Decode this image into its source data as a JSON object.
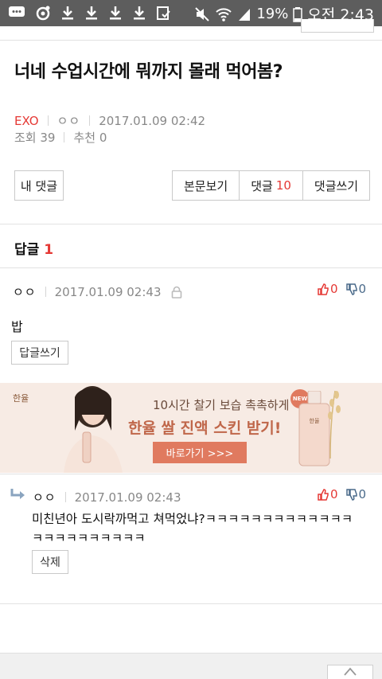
{
  "status_bar": {
    "battery_percent": "19%",
    "time": "오전 2:43"
  },
  "post": {
    "title": "너네 수업시간에 뭐까지 몰래 먹어봄?",
    "category": "EXO",
    "author": "ㅇㅇ",
    "datetime": "2017.01.09 02:42",
    "views": "조회 39",
    "recommends": "추천 0"
  },
  "actions": {
    "my_comments": "내 댓글",
    "view_post": "본문보기",
    "comments_label": "댓글",
    "comments_count": "10",
    "write_comment": "댓글쓰기"
  },
  "replies_section": {
    "label": "답글",
    "count": "1"
  },
  "comments": [
    {
      "author": "ㅇㅇ",
      "datetime": "2017.01.09 02:43",
      "likes": "0",
      "dislikes": "0",
      "text": "밥",
      "button": "답글쓰기"
    },
    {
      "author": "ㅇㅇ",
      "datetime": "2017.01.09 02:43",
      "likes": "0",
      "dislikes": "0",
      "text_line1": "미친년아 도시락까먹고 쳐먹었냐?ㅋㅋㅋㅋㅋㅋㅋㅋㅋㅋㅋㅋㅋ",
      "text_line2": "ㅋㅋㅋㅋㅋㅋㅋㅋㅋㅋ",
      "button": "삭제"
    }
  ],
  "ad": {
    "brand": "한율",
    "line1": "10시간 촉촉하게",
    "line1_full": "10시간 찰기 보습 촉촉하게",
    "line2": "한율 쌀 진액 스킨 받기!",
    "cta": "바로가기 >>>",
    "badge": "NEW",
    "bottle_label": "한율"
  }
}
